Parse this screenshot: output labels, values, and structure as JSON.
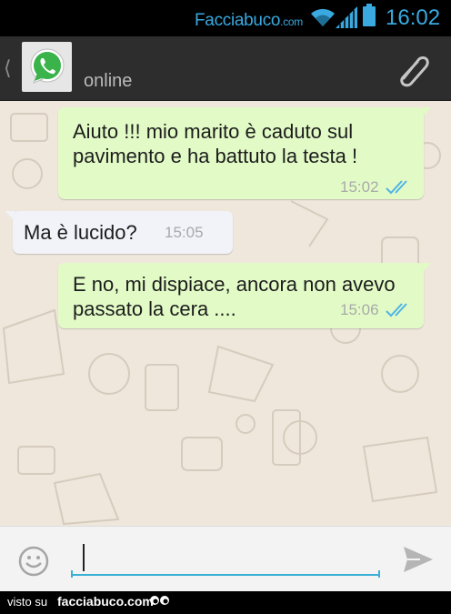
{
  "status_bar": {
    "brand": "Facciabuco",
    "brand_tld": ".com",
    "time": "16:02",
    "icons": [
      "wifi-icon",
      "signal-icon",
      "battery-icon"
    ],
    "accent_color": "#39a9e0"
  },
  "header": {
    "contact_status": "online",
    "avatar_icon": "whatsapp-logo-icon",
    "attach_icon": "paperclip-icon"
  },
  "messages": [
    {
      "direction": "outgoing",
      "text_lines": [
        "Aiuto !!! mio marito è caduto sul",
        "pavimento e ha battuto la testa !"
      ],
      "time": "15:02",
      "status": "read"
    },
    {
      "direction": "incoming",
      "text_lines": [
        "Ma è lucido?"
      ],
      "time": "15:05"
    },
    {
      "direction": "outgoing",
      "text_lines": [
        "E no, mi dispiace, ancora non avevo",
        "passato la cera ...."
      ],
      "time": "15:06",
      "status": "read"
    }
  ],
  "input_bar": {
    "value": "",
    "emoji_icon": "smiley-icon",
    "send_icon": "send-icon"
  },
  "footer": {
    "visto_su": "visto su",
    "site": "facciabuco.com"
  },
  "colors": {
    "outgoing_bubble": "#e2fbc6",
    "incoming_bubble": "#f1f3f8",
    "chat_background": "#efe7dc",
    "read_ticks": "#4fb3e6"
  }
}
